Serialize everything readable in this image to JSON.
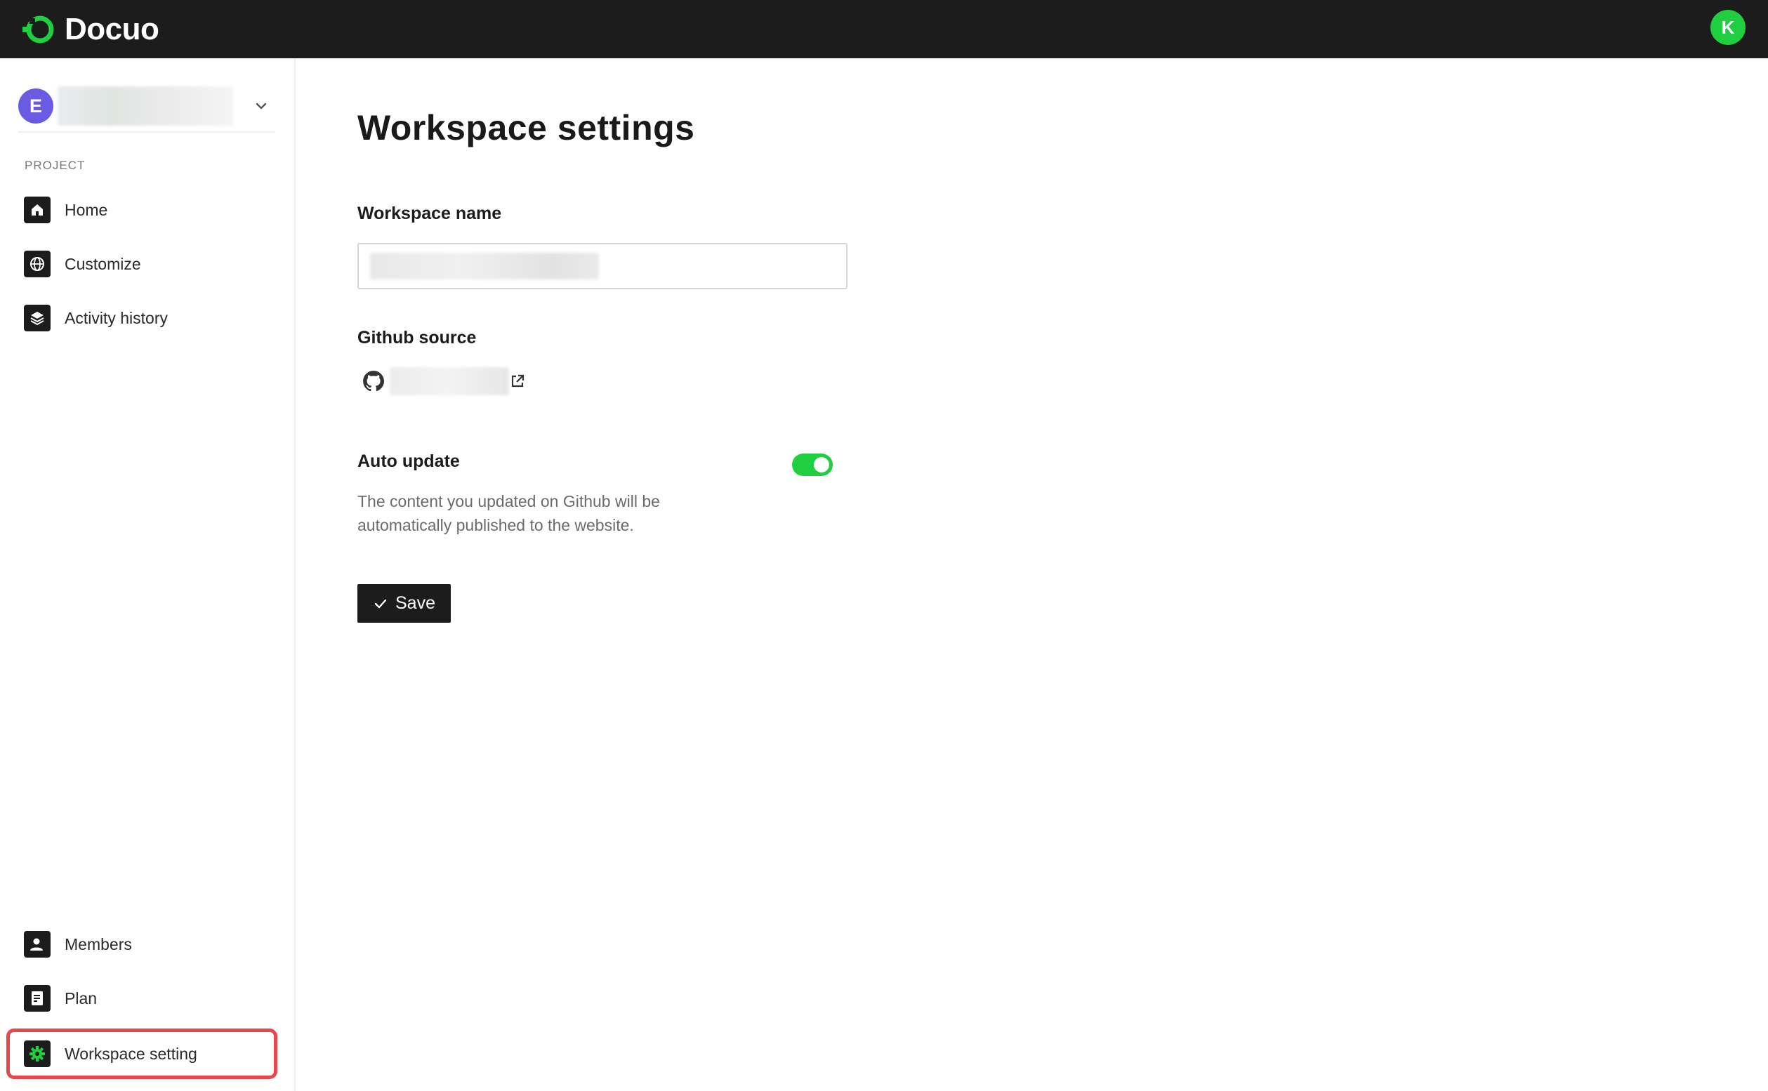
{
  "app": {
    "name": "Docuo",
    "user_initial": "K",
    "accent_color": "#1fcf3f"
  },
  "workspace": {
    "initial": "E"
  },
  "sidebar": {
    "section_label": "PROJECT",
    "items": [
      {
        "label": "Home",
        "icon": "home-icon"
      },
      {
        "label": "Customize",
        "icon": "globe-icon"
      },
      {
        "label": "Activity history",
        "icon": "layers-icon"
      }
    ],
    "bottom_items": [
      {
        "label": "Members",
        "icon": "user-icon"
      },
      {
        "label": "Plan",
        "icon": "document-icon"
      },
      {
        "label": "Workspace setting",
        "icon": "gear-icon",
        "active": true
      }
    ],
    "highlight_color": "#e5484d"
  },
  "main": {
    "title": "Workspace settings",
    "workspace_name_label": "Workspace name",
    "github_source_label": "Github source",
    "auto_update_label": "Auto update",
    "auto_update_enabled": true,
    "auto_update_help": "The content you updated on Github will be automatically published to the website.",
    "save_label": "Save"
  }
}
